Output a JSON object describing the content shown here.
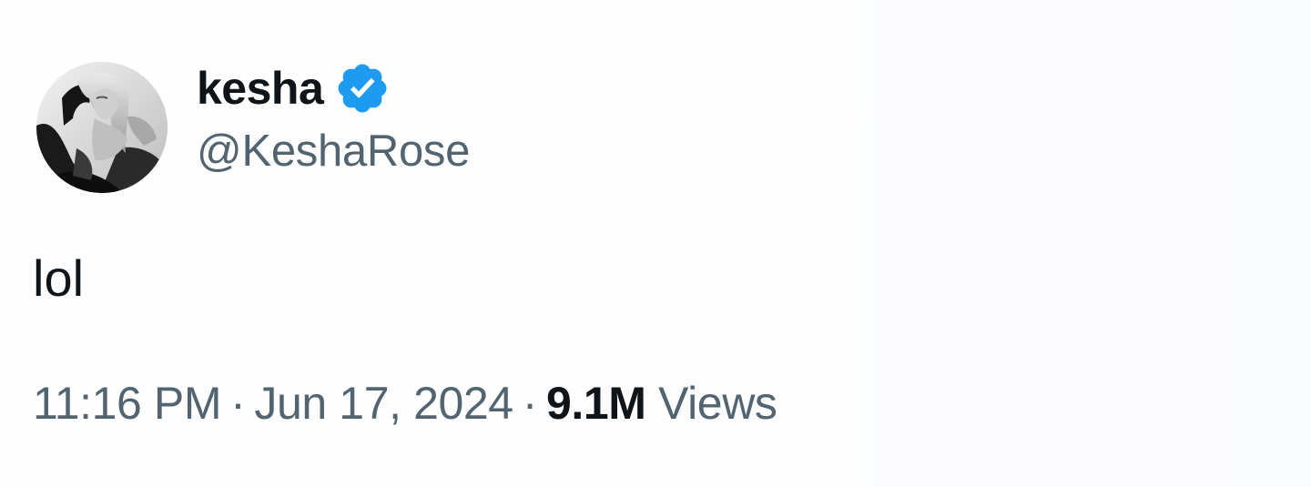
{
  "author": {
    "display_name": "kesha",
    "handle": "@KeshaRose",
    "verified_icon": "verified-badge-icon",
    "badge_color": "#1d9bf0"
  },
  "tweet": {
    "text": "lol"
  },
  "meta": {
    "time": "11:16 PM",
    "date": "Jun 17, 2024",
    "separator": "·",
    "views_count": "9.1M",
    "views_label": "Views"
  },
  "colors": {
    "primary_text": "#0f1419",
    "secondary_text": "#536471"
  }
}
